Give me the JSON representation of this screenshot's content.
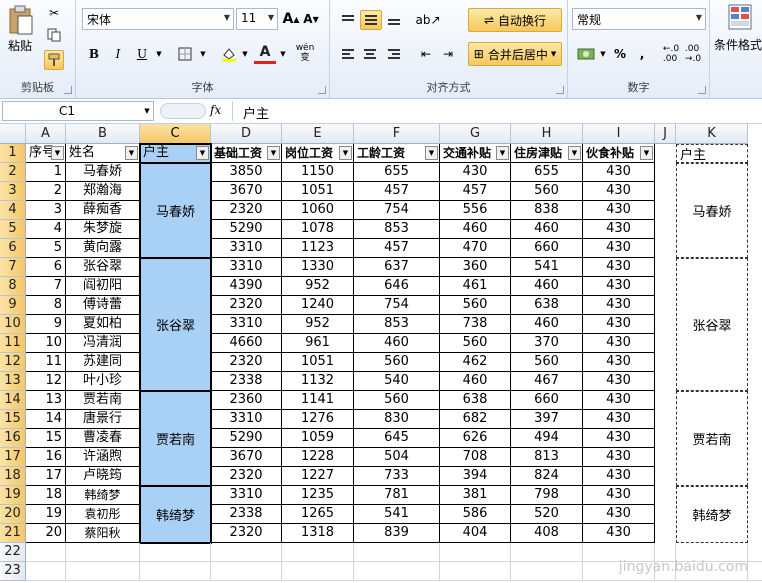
{
  "ribbon": {
    "clipboard": {
      "paste": "粘贴",
      "label": "剪贴板"
    },
    "font": {
      "name": "宋体",
      "size": "11",
      "label": "字体",
      "bold": "B",
      "italic": "I",
      "underline": "U",
      "grow": "A",
      "shrink": "A",
      "font_color": "A",
      "wen": "wén\n变"
    },
    "align": {
      "wrap": "自动换行",
      "merge": "合并后居中",
      "label": "对齐方式"
    },
    "number": {
      "format": "常规",
      "label": "数字",
      "percent": "%",
      "comma": ","
    },
    "styles": {
      "conditional": "条件格式"
    },
    "colors": {
      "accent": "#f7c85c",
      "selection": "#a9d0f5"
    }
  },
  "formula_bar": {
    "name_box": "C1",
    "fx": "fx",
    "content": "户主"
  },
  "columns": [
    "A",
    "B",
    "C",
    "D",
    "E",
    "F",
    "G",
    "H",
    "I",
    "J",
    "K"
  ],
  "headers": [
    "序号",
    "姓名",
    "户主",
    "基础工资",
    "岗位工资",
    "工龄工资",
    "交通补贴",
    "住房津贴",
    "伙食补贴"
  ],
  "rows": [
    [
      "1",
      "马春娇",
      "3850",
      "1150",
      "655",
      "430",
      "655",
      "430"
    ],
    [
      "2",
      "郑瀚海",
      "3670",
      "1051",
      "457",
      "457",
      "560",
      "430"
    ],
    [
      "3",
      "薛痴香",
      "2320",
      "1060",
      "754",
      "556",
      "838",
      "430"
    ],
    [
      "4",
      "朱梦旋",
      "5290",
      "1078",
      "853",
      "460",
      "460",
      "430"
    ],
    [
      "5",
      "黄向露",
      "3310",
      "1123",
      "457",
      "470",
      "660",
      "430"
    ],
    [
      "6",
      "张谷翠",
      "3310",
      "1330",
      "637",
      "360",
      "541",
      "430"
    ],
    [
      "7",
      "阎初阳",
      "4390",
      "952",
      "646",
      "461",
      "460",
      "430"
    ],
    [
      "8",
      "傅诗蕾",
      "2320",
      "1240",
      "754",
      "560",
      "638",
      "430"
    ],
    [
      "9",
      "夏如柏",
      "3310",
      "952",
      "853",
      "738",
      "460",
      "430"
    ],
    [
      "10",
      "冯清润",
      "4660",
      "961",
      "460",
      "560",
      "370",
      "430"
    ],
    [
      "11",
      "苏建同",
      "2320",
      "1051",
      "560",
      "462",
      "560",
      "430"
    ],
    [
      "12",
      "叶小珍",
      "2338",
      "1132",
      "540",
      "460",
      "467",
      "430"
    ],
    [
      "13",
      "贾若南",
      "2360",
      "1141",
      "560",
      "638",
      "660",
      "430"
    ],
    [
      "14",
      "唐景行",
      "3310",
      "1276",
      "830",
      "682",
      "397",
      "430"
    ],
    [
      "15",
      "曹凌春",
      "5290",
      "1059",
      "645",
      "626",
      "494",
      "430"
    ],
    [
      "16",
      "许涵煦",
      "3670",
      "1228",
      "504",
      "708",
      "813",
      "430"
    ],
    [
      "17",
      "卢晓筠",
      "2320",
      "1227",
      "733",
      "394",
      "824",
      "430"
    ],
    [
      "18",
      "韩绮梦",
      "3310",
      "1235",
      "781",
      "381",
      "798",
      "430"
    ],
    [
      "19",
      "袁初彤",
      "2338",
      "1265",
      "541",
      "586",
      "520",
      "430"
    ],
    [
      "20",
      "蔡阳秋",
      "2320",
      "1318",
      "839",
      "404",
      "408",
      "430"
    ]
  ],
  "groups": [
    "马春娇",
    "张谷翠",
    "贾若南",
    "韩绮梦"
  ],
  "k_header": "户主",
  "row_numbers": [
    "1",
    "2",
    "3",
    "4",
    "5",
    "6",
    "7",
    "8",
    "9",
    "10",
    "11",
    "12",
    "13",
    "14",
    "15",
    "16",
    "17",
    "18",
    "19",
    "20",
    "21",
    "22",
    "23"
  ],
  "watermark": "jingyan.baidu.com"
}
